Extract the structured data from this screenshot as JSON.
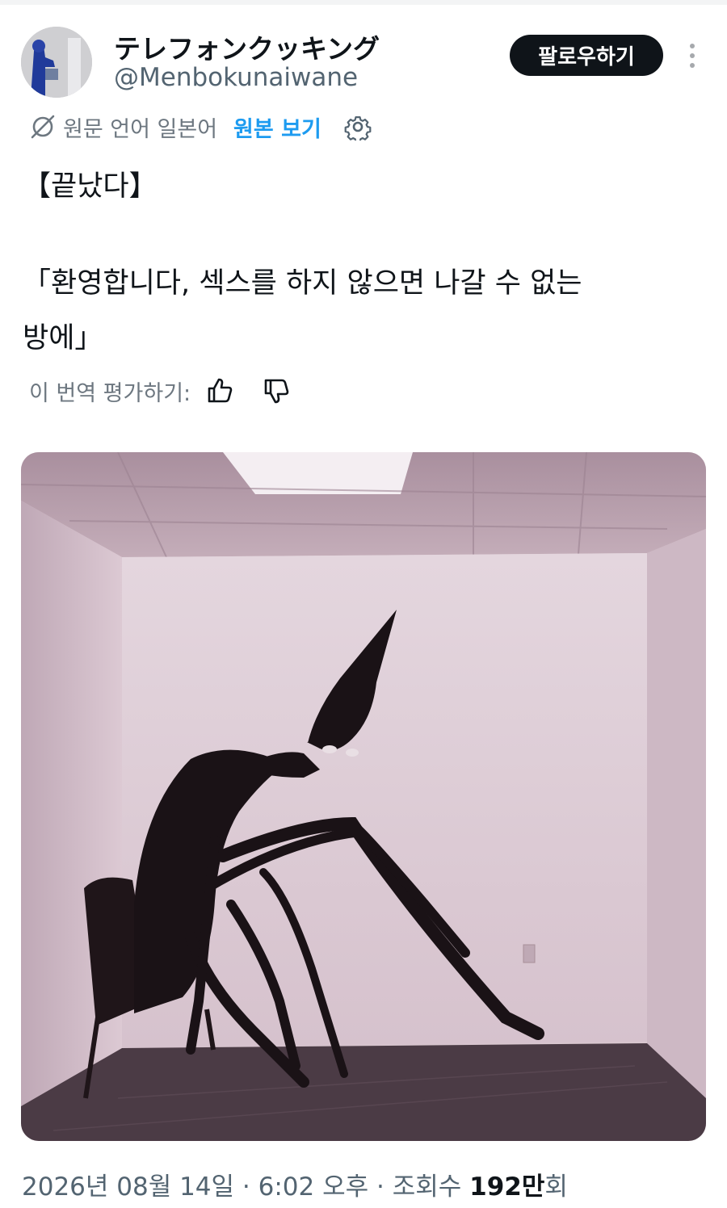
{
  "author": {
    "display_name": "テレフォンクッキング",
    "handle": "@Menbokunaiwane",
    "follow_label": "팔로우하기"
  },
  "translation": {
    "source_language_note": "원문 언어 일본어",
    "view_original_label": "원본 보기",
    "rate_label": "이 번역 평가하기:"
  },
  "tweet": {
    "line1": "【끝났다】",
    "line2": "「환영합니다, 섹스를 하지 않으면 나갈 수 없는",
    "line3": "방에」"
  },
  "meta": {
    "date": "2026년 08월 14일",
    "time": "6:02 오후",
    "views_label": "조회수",
    "views_number": "192만",
    "views_suffix": "회"
  },
  "icons": {
    "globe": "globe-slash-icon",
    "settings": "gear-icon",
    "rate_up": "thumbs-up-icon",
    "rate_down": "thumbs-down-icon",
    "more": "more-vertical-icon"
  },
  "colors": {
    "link": "#1d9bf0",
    "follow_bg": "#0f1419",
    "secondary_text": "#536471"
  }
}
